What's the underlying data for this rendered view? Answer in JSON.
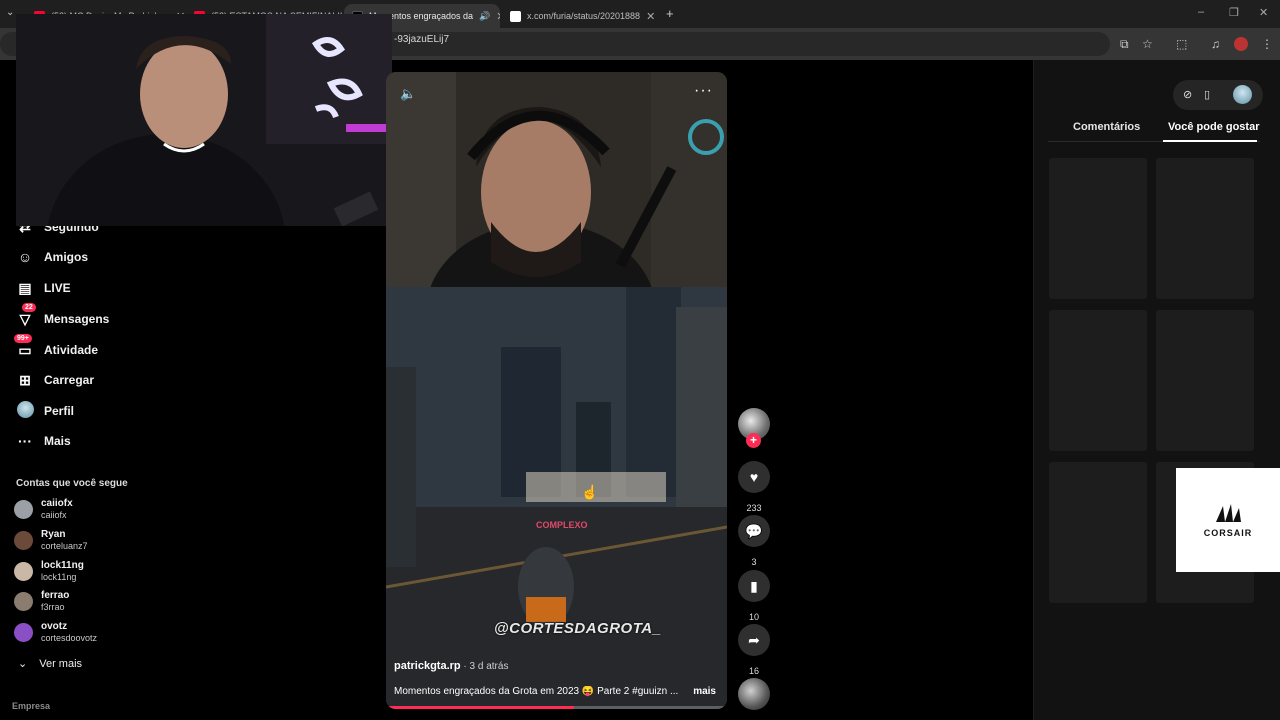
{
  "browser": {
    "tabs": [
      {
        "title": "(52) MC Davi e Mc Pedrinho - ",
        "favicon_color": "#ff0033"
      },
      {
        "title": "(52) ESTAMOS NA SEMIFINAL!!",
        "favicon_color": "#ff0033"
      },
      {
        "title": "Momentos engraçados da",
        "favicon_color": "#000000",
        "active": true
      },
      {
        "title": "x.com/furia/status/20201888",
        "favicon_color": "#ffffff"
      }
    ],
    "url": "-93jazuELij7"
  },
  "sidebar": {
    "nav": [
      {
        "label": "Seguindo",
        "icon": "following-icon"
      },
      {
        "label": "Amigos",
        "icon": "friends-icon"
      },
      {
        "label": "LIVE",
        "icon": "live-icon"
      },
      {
        "label": "Mensagens",
        "icon": "messages-icon",
        "badge": "22"
      },
      {
        "label": "Atividade",
        "icon": "activity-icon",
        "badge": "99+"
      },
      {
        "label": "Carregar",
        "icon": "upload-icon"
      },
      {
        "label": "Perfil",
        "icon": "profile-avatar-icon"
      },
      {
        "label": "Mais",
        "icon": "more-icon"
      }
    ],
    "following_title": "Contas que você segue",
    "accounts": [
      {
        "name": "caiiofx",
        "handle": "caiiofx",
        "color": "#9aa0a6"
      },
      {
        "name": "Ryan",
        "handle": "corteluanz7",
        "color": "#6b4a3a"
      },
      {
        "name": "lock11ng",
        "handle": "lock11ng",
        "color": "#c9b8a6"
      },
      {
        "name": "ferrao",
        "handle": "f3rrao",
        "color": "#8a7d70"
      },
      {
        "name": "ovotz",
        "handle": "cortesdoovotz",
        "color": "#8a4fc4"
      }
    ],
    "see_more": "Ver mais",
    "footer": "Empresa"
  },
  "video": {
    "overlay_brand": "COMPLEXO",
    "watermark": "@CORTESDAGROTA_",
    "author": "patrickgta.rp",
    "time": " · 3 d atrás",
    "caption": "Momentos engraçados da Grota em 2023 😝 Parte 2 #guuizn ...",
    "more_label": "mais",
    "progress": 0.55
  },
  "actions": {
    "likes": "233",
    "comments": "3",
    "saves": "10",
    "shares": "16"
  },
  "right_panel": {
    "tab_comments": "Comentários",
    "tab_may_like": "Você pode gostar",
    "ad_brand": "CORSAIR"
  }
}
